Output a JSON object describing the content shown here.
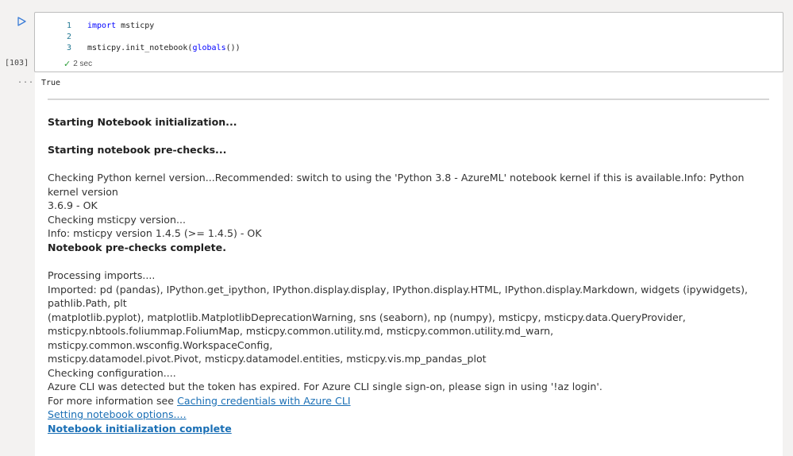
{
  "cell": {
    "execution_count": "[103]",
    "output_prompt": "...",
    "code_lines": [
      {
        "num": "1",
        "keyword": "import",
        "rest": " msticpy"
      },
      {
        "num": "2",
        "text": ""
      },
      {
        "num": "3",
        "prefix": "msticpy.init_notebook(",
        "func": "globals",
        "suffix": "())"
      }
    ],
    "status": {
      "icon": "check-icon",
      "duration": "2 sec"
    }
  },
  "output": {
    "return_value": "True",
    "heading_init": "Starting Notebook initialization...",
    "heading_prechecks": "Starting notebook pre-checks...",
    "kernel_check_line1": "Checking Python kernel version...Recommended: switch to using the 'Python 3.8 - AzureML' notebook kernel if this is available.Info: Python kernel version",
    "kernel_check_line2": "3.6.9 - OK",
    "msticpy_check": "Checking msticpy version...",
    "msticpy_info": "Info: msticpy version 1.4.5 (>= 1.4.5) - OK",
    "prechecks_complete": "Notebook pre-checks complete.",
    "processing_imports": "Processing imports....",
    "imported_lines": [
      "Imported: pd (pandas), IPython.get_ipython, IPython.display.display, IPython.display.HTML, IPython.display.Markdown, widgets (ipywidgets), pathlib.Path, plt",
      "(matplotlib.pyplot), matplotlib.MatplotlibDeprecationWarning, sns (seaborn), np (numpy), msticpy, msticpy.data.QueryProvider,",
      "msticpy.nbtools.foliummap.FoliumMap, msticpy.common.utility.md, msticpy.common.utility.md_warn, msticpy.common.wsconfig.WorkspaceConfig,",
      "msticpy.datamodel.pivot.Pivot, msticpy.datamodel.entities, msticpy.vis.mp_pandas_plot"
    ],
    "checking_config": "Checking configuration....",
    "azure_cli_warning": "Azure CLI was detected but the token has expired. For Azure CLI single sign-on, please sign in using '!az login'.",
    "more_info_prefix": "For more information see ",
    "more_info_link": "Caching credentials with Azure CLI",
    "setting_options_link": "Setting notebook options....",
    "init_complete_link": "Notebook initialization complete"
  }
}
